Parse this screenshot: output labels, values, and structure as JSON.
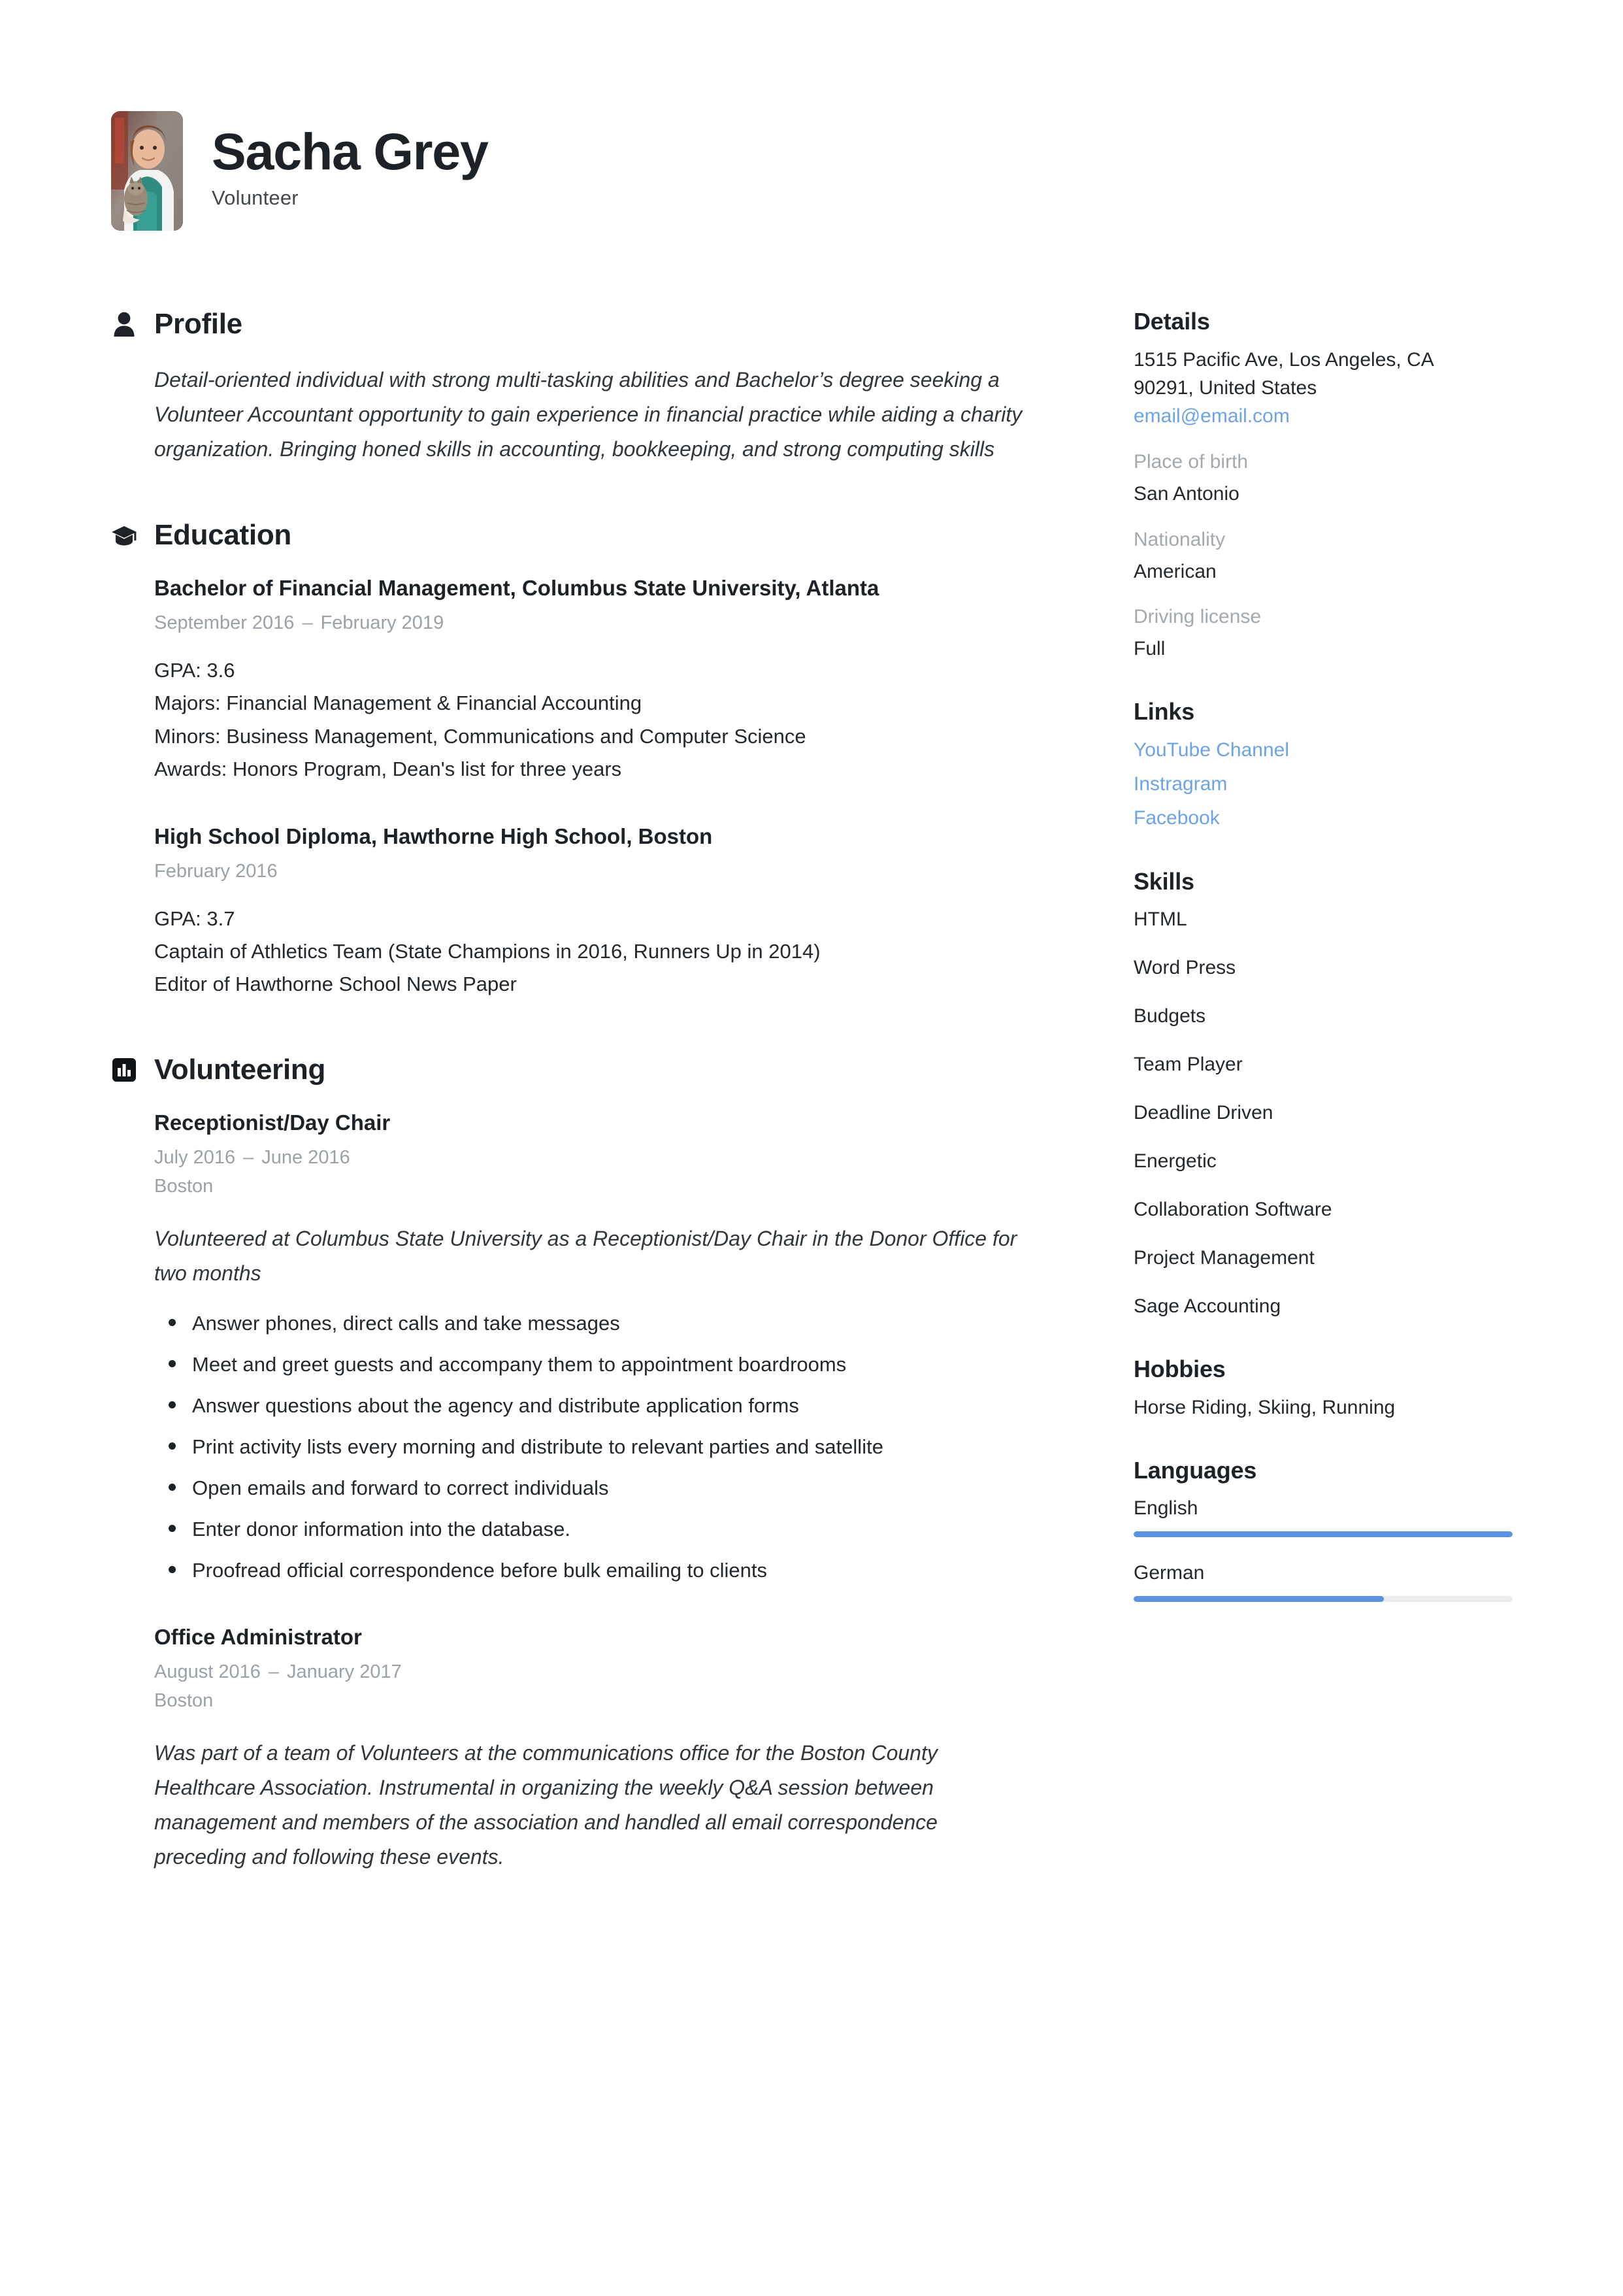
{
  "header": {
    "name": "Sacha Grey",
    "job_title": "Volunteer",
    "avatar_alt": "photo-of-volunteer-holding-kitten"
  },
  "sections": {
    "profile": {
      "title": "Profile",
      "icon": "person-icon",
      "summary": "Detail-oriented individual with strong multi-tasking abilities and Bachelor’s degree seeking a Volunteer Accountant opportunity to gain experience in financial practice while aiding a charity organization. Bringing honed skills in accounting, bookkeeping, and strong computing skills"
    },
    "education": {
      "title": "Education",
      "icon": "graduation-cap-icon",
      "entries": [
        {
          "title": "Bachelor of Financial Management, Columbus State University, Atlanta",
          "start": "September 2016",
          "end": "February 2019",
          "lines": [
            "GPA: 3.6",
            "Majors: Financial Management & Financial Accounting",
            "Minors: Business Management, Communications and Computer Science",
            "Awards: Honors Program, Dean's list for three years"
          ]
        },
        {
          "title": "High School Diploma, Hawthorne High School, Boston",
          "start": "February 2016",
          "end": "",
          "lines": [
            "GPA: 3.7",
            "Captain of Athletics Team (State Champions in 2016, Runners Up in 2014)",
            "Editor of Hawthorne School News Paper"
          ]
        }
      ]
    },
    "volunteering": {
      "title": "Volunteering",
      "icon": "bar-chart-icon",
      "entries": [
        {
          "title": "Receptionist/Day Chair",
          "start": "July 2016",
          "end": "June 2016",
          "location": "Boston",
          "description": "Volunteered at Columbus State University as a Receptionist/Day Chair in the Donor Office for two months",
          "bullets": [
            "Answer phones, direct calls and take messages",
            "Meet and greet guests and accompany them to appointment boardrooms",
            "Answer questions about the agency and distribute application forms",
            "Print activity lists every morning and distribute to relevant parties and satellite",
            "Open emails and forward to correct individuals",
            "Enter donor information into the database.",
            "Proofread official correspondence before bulk emailing to clients"
          ]
        },
        {
          "title": "Office Administrator",
          "start": "August 2016",
          "end": "January 2017",
          "location": "Boston",
          "description": "Was part of a team of Volunteers at the communications office for the Boston County Healthcare Association. Instrumental in organizing the weekly Q&A session between management and members of the association and handled all email correspondence preceding and following these events.",
          "bullets": []
        }
      ]
    }
  },
  "sidebar": {
    "details": {
      "title": "Details",
      "address_line1": "1515 Pacific Ave, Los Angeles, CA",
      "address_line2": "90291, United States",
      "email": "email@email.com",
      "fields": [
        {
          "label": "Place of birth",
          "value": "San Antonio"
        },
        {
          "label": "Nationality",
          "value": "American"
        },
        {
          "label": "Driving license",
          "value": "Full"
        }
      ]
    },
    "links": {
      "title": "Links",
      "items": [
        "YouTube Channel",
        "Instragram",
        "Facebook"
      ]
    },
    "skills": {
      "title": "Skills",
      "items": [
        "HTML",
        "Word Press",
        "Budgets",
        "Team Player",
        "Deadline Driven",
        "Energetic",
        "Collaboration Software",
        "Project Management",
        "Sage Accounting"
      ]
    },
    "hobbies": {
      "title": "Hobbies",
      "text": "Horse Riding, Skiing, Running"
    },
    "languages": {
      "title": "Languages",
      "items": [
        {
          "name": "English",
          "level_percent": 100
        },
        {
          "name": "German",
          "level_percent": 66
        }
      ]
    }
  },
  "colors": {
    "text": "#1d2228",
    "muted": "#9aa1a8",
    "link": "#6ca3e6",
    "bar_fill": "#5b93e0",
    "bar_track": "#ececed"
  }
}
